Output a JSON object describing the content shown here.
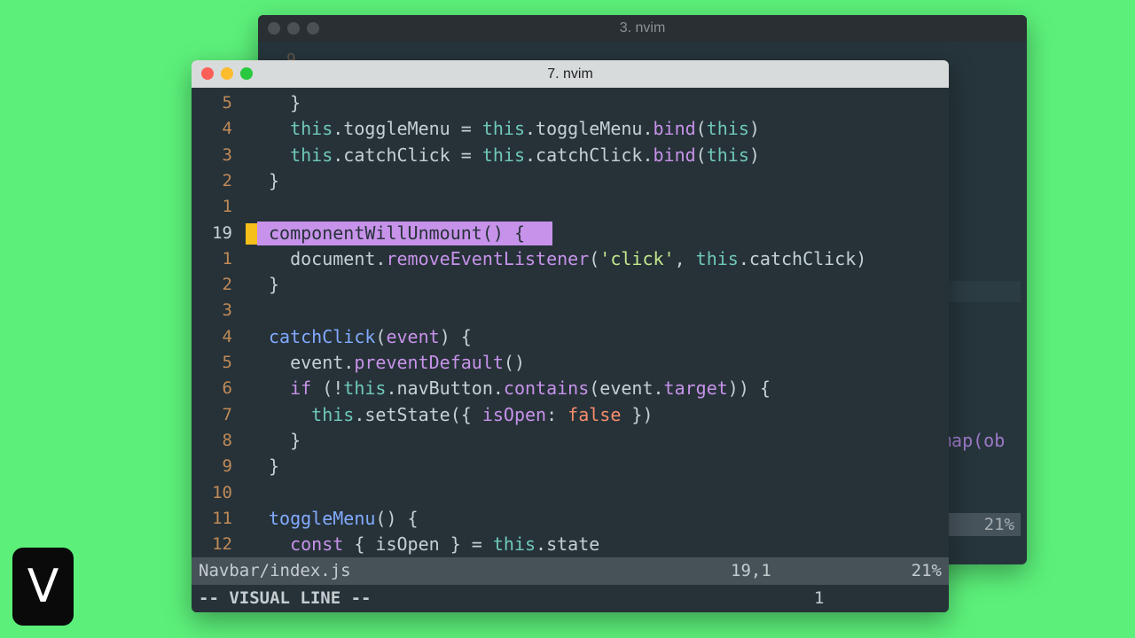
{
  "background_window": {
    "title": "3. nvim",
    "first_gutter": "9",
    "highlight_text": "map(ob",
    "status_percent": "21%"
  },
  "window": {
    "title": "7. nvim"
  },
  "editor": {
    "lines": [
      {
        "num": "5",
        "tokens": [
          {
            "t": "  }",
            "c": "pl"
          }
        ]
      },
      {
        "num": "4",
        "tokens": [
          {
            "t": "  this",
            "c": "th"
          },
          {
            "t": ".toggleMenu = ",
            "c": "pl"
          },
          {
            "t": "this",
            "c": "th"
          },
          {
            "t": ".toggleMenu.",
            "c": "pl"
          },
          {
            "t": "bind",
            "c": "met"
          },
          {
            "t": "(",
            "c": "pl"
          },
          {
            "t": "this",
            "c": "th"
          },
          {
            "t": ")",
            "c": "pl"
          }
        ]
      },
      {
        "num": "3",
        "tokens": [
          {
            "t": "  this",
            "c": "th"
          },
          {
            "t": ".catchClick = ",
            "c": "pl"
          },
          {
            "t": "this",
            "c": "th"
          },
          {
            "t": ".catchClick.",
            "c": "pl"
          },
          {
            "t": "bind",
            "c": "met"
          },
          {
            "t": "(",
            "c": "pl"
          },
          {
            "t": "this",
            "c": "th"
          },
          {
            "t": ")",
            "c": "pl"
          }
        ]
      },
      {
        "num": "2",
        "tokens": [
          {
            "t": "}",
            "c": "pl"
          }
        ]
      },
      {
        "num": "1",
        "tokens": []
      },
      {
        "num": "19",
        "current": true,
        "selected": true,
        "tokens": [
          {
            "t": "componentWillUnmount() {",
            "c": "sel-text"
          }
        ]
      },
      {
        "num": "1",
        "tokens": [
          {
            "t": "  document.",
            "c": "pl"
          },
          {
            "t": "removeEventListener",
            "c": "met"
          },
          {
            "t": "(",
            "c": "pl"
          },
          {
            "t": "'click'",
            "c": "str"
          },
          {
            "t": ", ",
            "c": "pl"
          },
          {
            "t": "this",
            "c": "th"
          },
          {
            "t": ".catchClick)",
            "c": "pl"
          }
        ]
      },
      {
        "num": "2",
        "tokens": [
          {
            "t": "}",
            "c": "pl"
          }
        ]
      },
      {
        "num": "3",
        "tokens": []
      },
      {
        "num": "4",
        "tokens": [
          {
            "t": "catchClick",
            "c": "fn"
          },
          {
            "t": "(",
            "c": "pl"
          },
          {
            "t": "event",
            "c": "met"
          },
          {
            "t": ") {",
            "c": "pl"
          }
        ]
      },
      {
        "num": "5",
        "tokens": [
          {
            "t": "  event.",
            "c": "pl"
          },
          {
            "t": "preventDefault",
            "c": "met"
          },
          {
            "t": "()",
            "c": "pl"
          }
        ]
      },
      {
        "num": "6",
        "tokens": [
          {
            "t": "  if",
            "c": "kw"
          },
          {
            "t": " (!",
            "c": "pl"
          },
          {
            "t": "this",
            "c": "th"
          },
          {
            "t": ".navButton.",
            "c": "pl"
          },
          {
            "t": "contains",
            "c": "met"
          },
          {
            "t": "(event.",
            "c": "pl"
          },
          {
            "t": "target",
            "c": "met"
          },
          {
            "t": ")) {",
            "c": "pl"
          }
        ]
      },
      {
        "num": "7",
        "tokens": [
          {
            "t": "    this",
            "c": "th"
          },
          {
            "t": ".setState({ ",
            "c": "pl"
          },
          {
            "t": "isOpen",
            "c": "met"
          },
          {
            "t": ": ",
            "c": "pl"
          },
          {
            "t": "false",
            "c": "boo"
          },
          {
            "t": " })",
            "c": "pl"
          }
        ]
      },
      {
        "num": "8",
        "tokens": [
          {
            "t": "  }",
            "c": "pl"
          }
        ]
      },
      {
        "num": "9",
        "tokens": [
          {
            "t": "}",
            "c": "pl"
          }
        ]
      },
      {
        "num": "10",
        "tokens": []
      },
      {
        "num": "11",
        "tokens": [
          {
            "t": "toggleMenu",
            "c": "fn"
          },
          {
            "t": "() {",
            "c": "pl"
          }
        ]
      },
      {
        "num": "12",
        "tokens": [
          {
            "t": "  const",
            "c": "kw"
          },
          {
            "t": " { isOpen } = ",
            "c": "pl"
          },
          {
            "t": "this",
            "c": "th"
          },
          {
            "t": ".state",
            "c": "pl"
          }
        ]
      }
    ]
  },
  "statusline": {
    "filename": "Navbar/index.js",
    "position": "19,1",
    "percent": "21%"
  },
  "cmdline": {
    "mode": "-- VISUAL LINE --",
    "count": "1"
  },
  "logo": {
    "letter": "V"
  }
}
